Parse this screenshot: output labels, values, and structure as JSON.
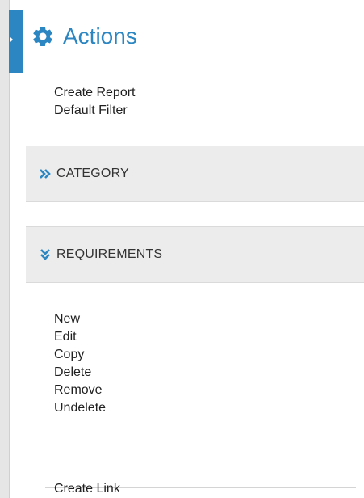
{
  "panel": {
    "title": "Actions",
    "title_icon": "gear-icon",
    "accent_color": "#2b86c2"
  },
  "top_actions": [
    {
      "label": "Create Report"
    },
    {
      "label": "Default Filter"
    }
  ],
  "sections": {
    "category": {
      "label": "CATEGORY",
      "icon": "double-chevron-right-icon",
      "expanded": false
    },
    "requirements": {
      "label": "REQUIREMENTS",
      "icon": "double-chevron-down-icon",
      "expanded": true
    }
  },
  "requirements_actions": [
    {
      "label": "New"
    },
    {
      "label": "Edit"
    },
    {
      "label": "Copy"
    },
    {
      "label": "Delete"
    },
    {
      "label": "Remove"
    },
    {
      "label": "Undelete"
    }
  ],
  "link_actions": [
    {
      "label": "Create Link"
    }
  ]
}
